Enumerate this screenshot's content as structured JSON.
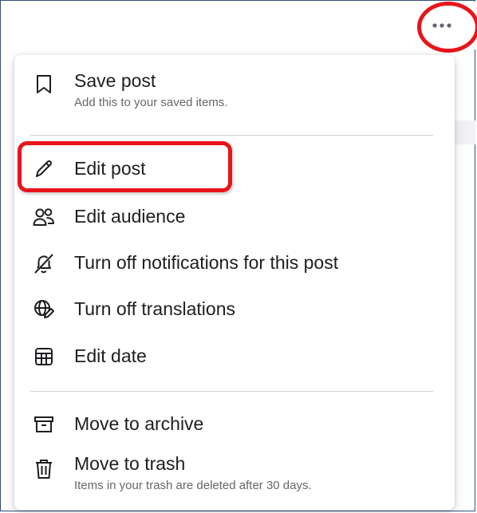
{
  "header": {
    "more_button_icon": "more-horizontal-icon"
  },
  "menu": {
    "items": [
      {
        "label": "Save post",
        "sublabel": "Add this to your saved items.",
        "icon": "bookmark-icon"
      },
      {
        "label": "Edit post",
        "icon": "pencil-icon"
      },
      {
        "label": "Edit audience",
        "icon": "people-icon"
      },
      {
        "label": "Turn off notifications for this post",
        "icon": "bell-off-icon"
      },
      {
        "label": "Turn off translations",
        "icon": "globe-pencil-icon"
      },
      {
        "label": "Edit date",
        "icon": "calendar-icon"
      },
      {
        "label": "Move to archive",
        "icon": "archive-icon"
      },
      {
        "label": "Move to trash",
        "sublabel": "Items in your trash are deleted after 30 days.",
        "icon": "trash-icon"
      }
    ]
  },
  "colors": {
    "highlight": "#e8141b",
    "text_primary": "#1c1e21",
    "text_secondary": "#65676b",
    "divider": "#ced0d4"
  }
}
